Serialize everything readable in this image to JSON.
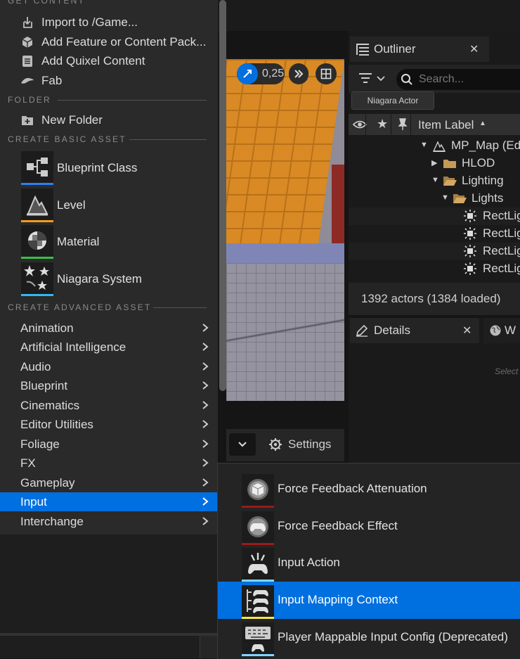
{
  "colors": {
    "accent": "#0070e0",
    "blueprint_bar": "#2f7df6",
    "level_bar": "#f39a1e",
    "material_bar": "#3dbb4a",
    "niagara_bar": "#33b8f0",
    "force_feedback_bar": "#9b1a1a",
    "input_bar": "#7fd6ff",
    "input_mapping_bar": "#f3e64a"
  },
  "menu": {
    "sections": {
      "get_content": "GET CONTENT",
      "folder": "FOLDER",
      "create_basic": "CREATE BASIC ASSET",
      "create_advanced": "CREATE ADVANCED ASSET"
    },
    "get_content_items": [
      {
        "label": "Import to /Game...",
        "icon": "import-icon"
      },
      {
        "label": "Add Feature or Content Pack...",
        "icon": "feature-pack-icon"
      },
      {
        "label": "Add Quixel Content",
        "icon": "quixel-icon"
      },
      {
        "label": "Fab",
        "icon": "fab-icon"
      }
    ],
    "folder_items": [
      {
        "label": "New Folder",
        "icon": "new-folder-icon"
      }
    ],
    "basic_assets": [
      {
        "label": "Blueprint Class",
        "icon": "blueprint-class-icon"
      },
      {
        "label": "Level",
        "icon": "level-icon"
      },
      {
        "label": "Material",
        "icon": "material-icon"
      },
      {
        "label": "Niagara System",
        "icon": "niagara-system-icon"
      }
    ],
    "advanced_assets": [
      {
        "label": "Animation"
      },
      {
        "label": "Artificial Intelligence"
      },
      {
        "label": "Audio"
      },
      {
        "label": "Blueprint"
      },
      {
        "label": "Cinematics"
      },
      {
        "label": "Editor Utilities"
      },
      {
        "label": "Foliage"
      },
      {
        "label": "FX"
      },
      {
        "label": "Gameplay"
      },
      {
        "label": "Input",
        "selected": true
      },
      {
        "label": "Interchange"
      }
    ]
  },
  "submenu": {
    "items": [
      {
        "label": "Force Feedback Attenuation",
        "icon": "force-feedback-attenuation-icon"
      },
      {
        "label": "Force Feedback Effect",
        "icon": "force-feedback-effect-icon"
      },
      {
        "label": "Input Action",
        "icon": "input-action-icon"
      },
      {
        "label": "Input Mapping Context",
        "icon": "input-mapping-context-icon",
        "selected": true
      },
      {
        "label": "Player Mappable Input Config (Deprecated)",
        "icon": "keyboard-icon"
      }
    ]
  },
  "viewport": {
    "snap_value": "0,25"
  },
  "toolbar": {
    "settings_label": "Settings"
  },
  "outliner": {
    "tab_label": "Outliner",
    "search_placeholder": "Search...",
    "filter_chip": "Niagara Actor",
    "column_label": "Item Label",
    "tree": [
      {
        "label": "MP_Map (Ed",
        "icon": "map-icon"
      },
      {
        "label": "HLOD",
        "icon": "folder-icon"
      },
      {
        "label": "Lighting",
        "icon": "folder-open-icon"
      },
      {
        "label": "Lights",
        "icon": "folder-open-icon"
      },
      {
        "label": "RectLig",
        "icon": "rect-light-icon"
      },
      {
        "label": "RectLig",
        "icon": "rect-light-icon"
      },
      {
        "label": "RectLig",
        "icon": "rect-light-icon"
      },
      {
        "label": "RectLig",
        "icon": "rect-light-icon"
      }
    ],
    "status": "1392 actors (1384 loaded)"
  },
  "details": {
    "tab_label": "Details",
    "second_tab_label": "W",
    "hint": "Select"
  }
}
